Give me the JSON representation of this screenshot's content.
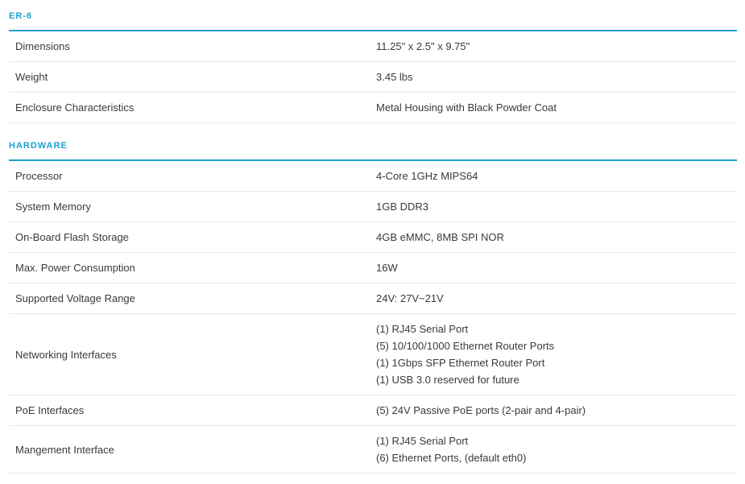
{
  "sections": [
    {
      "title": "ER-6",
      "rows": [
        {
          "label": "Dimensions",
          "values": [
            "11.25\" x 2.5\" x 9.75\""
          ]
        },
        {
          "label": "Weight",
          "values": [
            "3.45 lbs"
          ]
        },
        {
          "label": "Enclosure Characteristics",
          "values": [
            "Metal Housing with Black Powder Coat"
          ]
        }
      ]
    },
    {
      "title": "HARDWARE",
      "rows": [
        {
          "label": "Processor",
          "values": [
            "4-Core 1GHz MIPS64"
          ]
        },
        {
          "label": "System Memory",
          "values": [
            "1GB DDR3"
          ]
        },
        {
          "label": "On-Board Flash Storage",
          "values": [
            "4GB eMMC, 8MB SPI NOR"
          ]
        },
        {
          "label": "Max. Power Consumption",
          "values": [
            "16W"
          ]
        },
        {
          "label": "Supported Voltage Range",
          "values": [
            "24V: 27V~21V"
          ]
        },
        {
          "label": "Networking Interfaces",
          "values": [
            "(1) RJ45 Serial Port",
            "(5) 10/100/1000 Ethernet Router Ports",
            "(1) 1Gbps SFP Ethernet Router Port",
            "(1) USB 3.0 reserved for future"
          ]
        },
        {
          "label": "PoE Interfaces",
          "values": [
            "(5) 24V Passive PoE ports (2-pair and 4-pair)"
          ]
        },
        {
          "label": "Mangement Interface",
          "values": [
            "(1) RJ45 Serial Port",
            "(6) Ethernet Ports, (default eth0)"
          ]
        }
      ]
    }
  ],
  "colors": {
    "accent": "#1fa0cf",
    "text": "#3a3a3a",
    "row_divider": "#e6e6e6"
  }
}
